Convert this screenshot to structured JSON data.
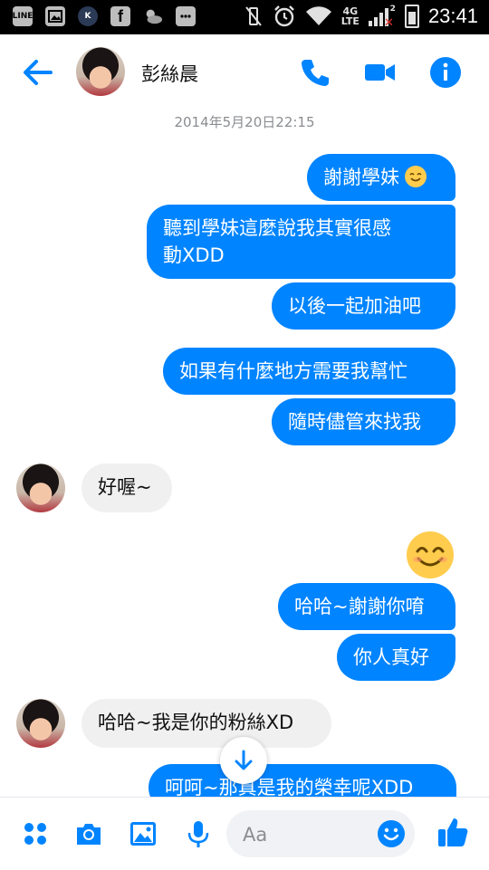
{
  "status_bar": {
    "left_icons": [
      "line-icon",
      "image-icon",
      "k-app-icon",
      "facebook-icon",
      "weather-icon",
      "chat-icon"
    ],
    "right_icons": [
      "vibrate-off-icon",
      "alarm-icon",
      "wifi-icon",
      "signal-icon",
      "battery-icon"
    ],
    "network": "4G",
    "network_sub": "LTE",
    "sim_slot": "2",
    "time": "23:41"
  },
  "header": {
    "contact_name": "彭絲晨",
    "icons": [
      "back-arrow-icon",
      "phone-icon",
      "video-camera-icon",
      "info-icon"
    ],
    "accent_color": "#0084ff"
  },
  "conversation": {
    "timestamp": "2014年5月20日22:15",
    "messages": [
      {
        "from": "me",
        "text": "謝謝學妹"
      },
      {
        "from": "me",
        "text": "聽到學妹這麼說我其實很感\n動XDD"
      },
      {
        "from": "me",
        "text": "以後一起加油吧"
      },
      {
        "from": "me",
        "text": "如果有什麼地方需要我幫忙"
      },
      {
        "from": "me",
        "text": "隨時儘管來找我"
      },
      {
        "from": "them",
        "text": "好喔~"
      },
      {
        "from": "me",
        "text": "哈哈~謝謝你唷"
      },
      {
        "from": "me",
        "text": "你人真好"
      },
      {
        "from": "them",
        "text": "哈哈~我是你的粉絲XD"
      },
      {
        "from": "me",
        "text": "呵呵~那真是我的榮幸呢XDD"
      }
    ],
    "bubble_colors": {
      "outgoing": "#0084ff",
      "incoming": "#f1f0f0"
    }
  },
  "composer": {
    "placeholder": "Aa",
    "icons": [
      "more-apps-icon",
      "camera-icon",
      "gallery-icon",
      "microphone-icon",
      "emoji-icon",
      "thumbs-up-icon"
    ]
  }
}
